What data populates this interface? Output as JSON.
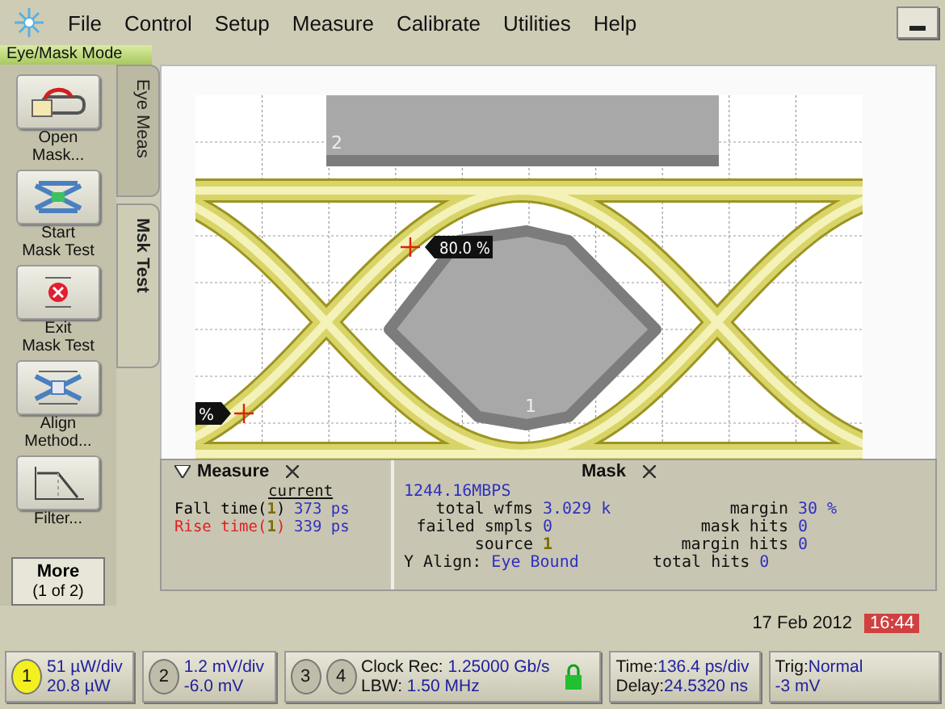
{
  "menu": [
    "File",
    "Control",
    "Setup",
    "Measure",
    "Calibrate",
    "Utilities",
    "Help"
  ],
  "mode_label": "Eye/Mask Mode",
  "tool_buttons": [
    {
      "kind": "open",
      "lines": [
        "Open",
        "Mask..."
      ]
    },
    {
      "kind": "start",
      "lines": [
        "Start",
        "Mask Test"
      ]
    },
    {
      "kind": "exit",
      "lines": [
        "Exit",
        "Mask Test"
      ]
    },
    {
      "kind": "align",
      "lines": [
        "Align",
        "Method..."
      ]
    },
    {
      "kind": "filter",
      "lines": [
        "Filter..."
      ]
    }
  ],
  "more_button": [
    "More",
    "(1 of 2)"
  ],
  "side_tabs": [
    {
      "label": "Eye Meas",
      "selected": false
    },
    {
      "label": "Msk Test",
      "selected": true
    }
  ],
  "display": {
    "mask_labels": [
      "2",
      "1"
    ],
    "markers": [
      {
        "label": "80.0 %"
      },
      {
        "label": "%"
      }
    ]
  },
  "measure_panel": {
    "title": "Measure",
    "column_header": "current",
    "rows": [
      {
        "name": "Fall time(",
        "source": "1",
        "close": ")",
        "value": "373 ps",
        "color": "#000000"
      },
      {
        "name": "Rise time(",
        "source": "1",
        "close": ")",
        "value": "339 ps",
        "color": "#e02020"
      }
    ]
  },
  "mask_panel": {
    "title": "Mask",
    "rate": "1244.16MBPS",
    "rows": [
      {
        "label": "total wfms",
        "value": "3.029 k",
        "label_2": "margin",
        "value_2": "30 %"
      },
      {
        "label": "failed smpls",
        "value": "0",
        "label_2": "mask hits",
        "value_2": "0"
      },
      {
        "label": "source",
        "value": "1",
        "kind": "source",
        "label_2": "margin hits",
        "value_2": "0"
      },
      {
        "label": "Y Align:",
        "value": "Eye Bound",
        "kind": "align",
        "label_2": "total hits",
        "value_2": "0"
      }
    ]
  },
  "date": "17 Feb 2012",
  "time": "16:44",
  "status_bar": {
    "channels": [
      {
        "number": "1",
        "on": true,
        "lines": [
          "51 µW/div",
          "20.8 µW"
        ]
      },
      {
        "number": "2",
        "on": false,
        "lines": [
          "1.2 mV/div",
          "-6.0 mV"
        ]
      }
    ],
    "clock": {
      "numbers": [
        "3",
        "4"
      ],
      "lines": [
        {
          "label": "Clock Rec:",
          "value": "1.25000 Gb/s"
        },
        {
          "label": "LBW:",
          "value": "1.50 MHz"
        }
      ],
      "locked": true
    },
    "timebase": [
      {
        "label": "Time:",
        "value": "136.4 ps/div"
      },
      {
        "label": "Delay:",
        "value": "24.5320 ns"
      }
    ],
    "trigger": [
      {
        "label": "Trig:",
        "value": "Normal"
      },
      {
        "value": "-3 mV"
      }
    ]
  }
}
